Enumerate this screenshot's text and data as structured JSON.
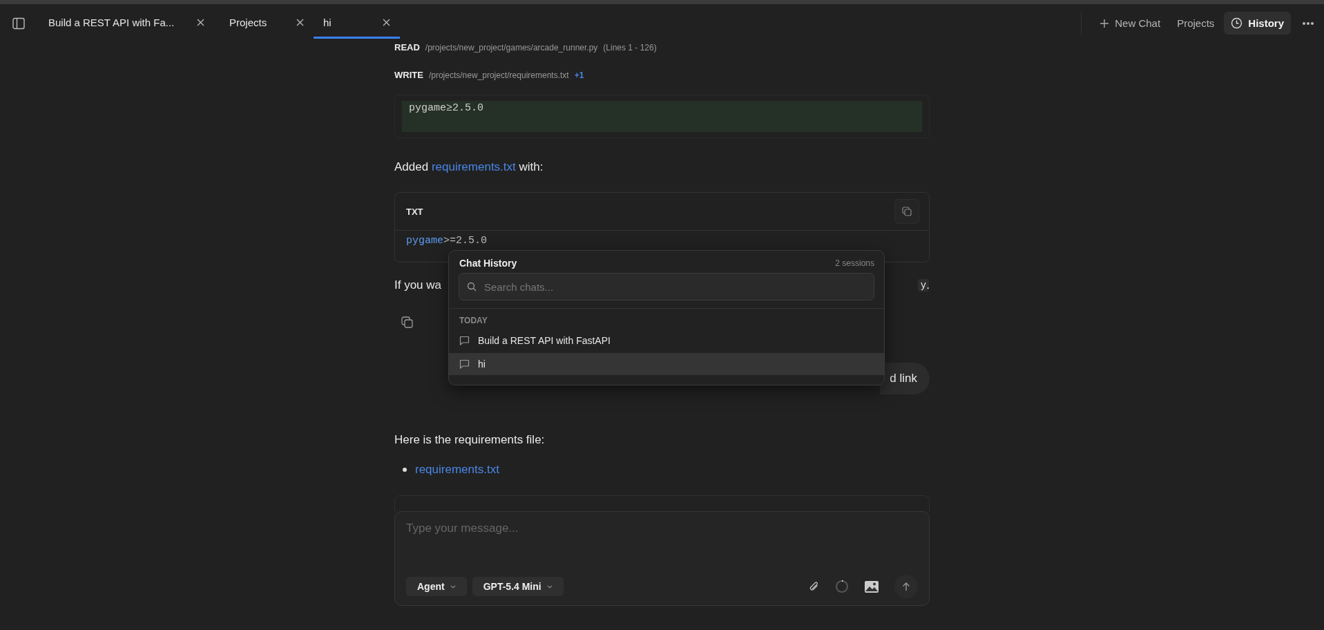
{
  "tabs": [
    {
      "label": "Build a REST API with Fa...",
      "selected": false
    },
    {
      "label": "Projects",
      "selected": false
    },
    {
      "label": "hi",
      "selected": true
    }
  ],
  "header_actions": [
    {
      "label": "New Chat",
      "kind": "new",
      "selected": false
    },
    {
      "label": "Projects",
      "kind": "plain",
      "selected": false
    },
    {
      "label": "History",
      "kind": "history",
      "selected": true
    }
  ],
  "tool_calls": [
    {
      "action": "READ",
      "path": "/projects/new_project/games/arcade_runner.py",
      "detail": "(Lines 1 - 126)"
    },
    {
      "action": "WRITE",
      "path": "/projects/new_project/requirements.txt",
      "badge": "+1"
    }
  ],
  "diff": {
    "lines": [
      "pygame≥2.5.0"
    ]
  },
  "reply_1": {
    "before": "Added",
    "link": "requirements.txt",
    "after": "with:"
  },
  "code_block": {
    "language": "TXT",
    "name": "pygame",
    "rest": ">=2.5.0"
  },
  "partial_line": {
    "text": "If you wa",
    "code": "y",
    "end": "."
  },
  "user_message": {
    "text": "d link"
  },
  "reply_2": {
    "text": "Here is the requirements file:",
    "links": [
      "requirements.txt"
    ]
  },
  "composer": {
    "placeholder": "Type your message...",
    "mode": "Agent",
    "model": "GPT-5.4 Mini"
  },
  "history_popup": {
    "title": "Chat History",
    "count": "2 sessions",
    "search_placeholder": "Search chats...",
    "group": "TODAY",
    "items": [
      {
        "title": "Build a REST API with FastAPI",
        "selected": false
      },
      {
        "title": "hi",
        "selected": true
      }
    ]
  }
}
